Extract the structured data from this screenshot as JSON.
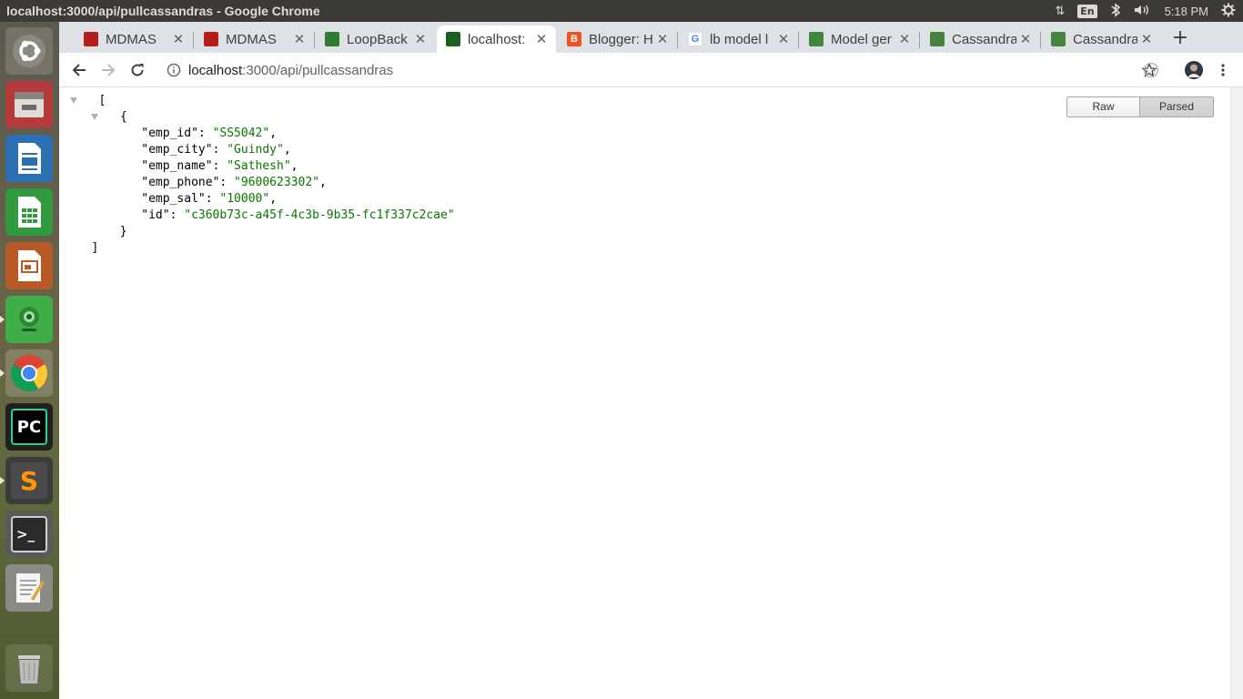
{
  "window_title": "localhost:3000/api/pullcassandras - Google Chrome",
  "panel": {
    "keyboard_layout": "En",
    "clock": "5:18 PM"
  },
  "tabs": [
    {
      "label": "MDMAS",
      "favicon": "mdmas-icon",
      "color": "#b71c1c"
    },
    {
      "label": "MDMAS",
      "favicon": "mdmas-icon",
      "color": "#b71c1c"
    },
    {
      "label": "LoopBack",
      "favicon": "loopback-icon",
      "color": "#2e7d32"
    },
    {
      "label": "localhost:",
      "favicon": "localhost-icon",
      "color": "#1b5e20",
      "active": true
    },
    {
      "label": "Blogger: H",
      "favicon": "blogger-icon",
      "color": "#f4511e"
    },
    {
      "label": "lb model l",
      "favicon": "google-icon",
      "color": "#4285f4"
    },
    {
      "label": "Model ger",
      "favicon": "nodejs-icon",
      "color": "#43853d"
    },
    {
      "label": "Cassandra",
      "favicon": "nodejs-icon",
      "color": "#43853d"
    },
    {
      "label": "Cassandra",
      "favicon": "nodejs-icon",
      "color": "#43853d"
    }
  ],
  "address_bar": {
    "host": "localhost",
    "path": ":3000/api/pullcassandras"
  },
  "viewer": {
    "raw_label": "Raw",
    "parsed_label": "Parsed",
    "selected": "Parsed"
  },
  "json_doc": {
    "open_bracket": "[",
    "close_bracket": "]",
    "open_brace": "{",
    "close_brace": "}",
    "fields": [
      {
        "key": "emp_id",
        "value": "SS5042"
      },
      {
        "key": "emp_city",
        "value": "Guindy"
      },
      {
        "key": "emp_name",
        "value": "Sathesh"
      },
      {
        "key": "emp_phone",
        "value": "9600623302"
      },
      {
        "key": "emp_sal",
        "value": "10000"
      },
      {
        "key": "id",
        "value": "c360b73c-a45f-4c3b-9b35-fc1f337c2cae"
      }
    ]
  },
  "launcher": [
    {
      "name": "ubuntu-dash-icon"
    },
    {
      "name": "files-icon"
    },
    {
      "name": "libreoffice-writer-icon"
    },
    {
      "name": "libreoffice-calc-icon"
    },
    {
      "name": "libreoffice-impress-icon"
    },
    {
      "name": "webcam-app-icon"
    },
    {
      "name": "chrome-icon"
    },
    {
      "name": "pycharm-icon",
      "text": "PC"
    },
    {
      "name": "sublime-text-icon",
      "text": "S"
    },
    {
      "name": "terminal-icon",
      "text": ">_"
    },
    {
      "name": "text-editor-icon"
    },
    {
      "name": "trash-icon"
    }
  ]
}
